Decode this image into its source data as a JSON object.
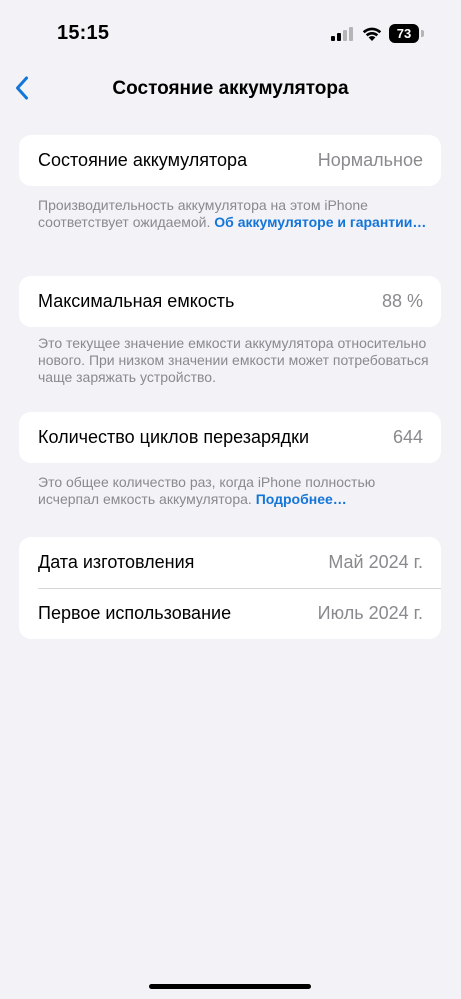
{
  "status": {
    "time": "15:15",
    "battery_level": "73"
  },
  "nav": {
    "title": "Состояние аккумулятора"
  },
  "health": {
    "label": "Состояние аккумулятора",
    "value": "Нормальное",
    "note_text": "Производительность аккумулятора на этом iPhone соответствует ожидаемой. ",
    "note_link": "Об аккумуляторе и гарантии…"
  },
  "capacity": {
    "label": "Максимальная емкость",
    "value": "88 %",
    "note_text": "Это текущее значение емкости аккумулятора относительно нового. При низком значении емкости может потребоваться чаще заряжать устройство."
  },
  "cycles": {
    "label": "Количество циклов перезарядки",
    "value": "644",
    "note_text": "Это общее количество раз, когда iPhone полностью исчерпал емкость аккумулятора. ",
    "note_link": "Подробнее…"
  },
  "dates": {
    "manufacture_label": "Дата изготовления",
    "manufacture_value": "Май 2024 г.",
    "first_use_label": "Первое использование",
    "first_use_value": "Июль 2024 г."
  },
  "colors": {
    "accent": "#1475d9",
    "background": "#f2f2f7",
    "secondary_text": "#8a8a8e"
  }
}
